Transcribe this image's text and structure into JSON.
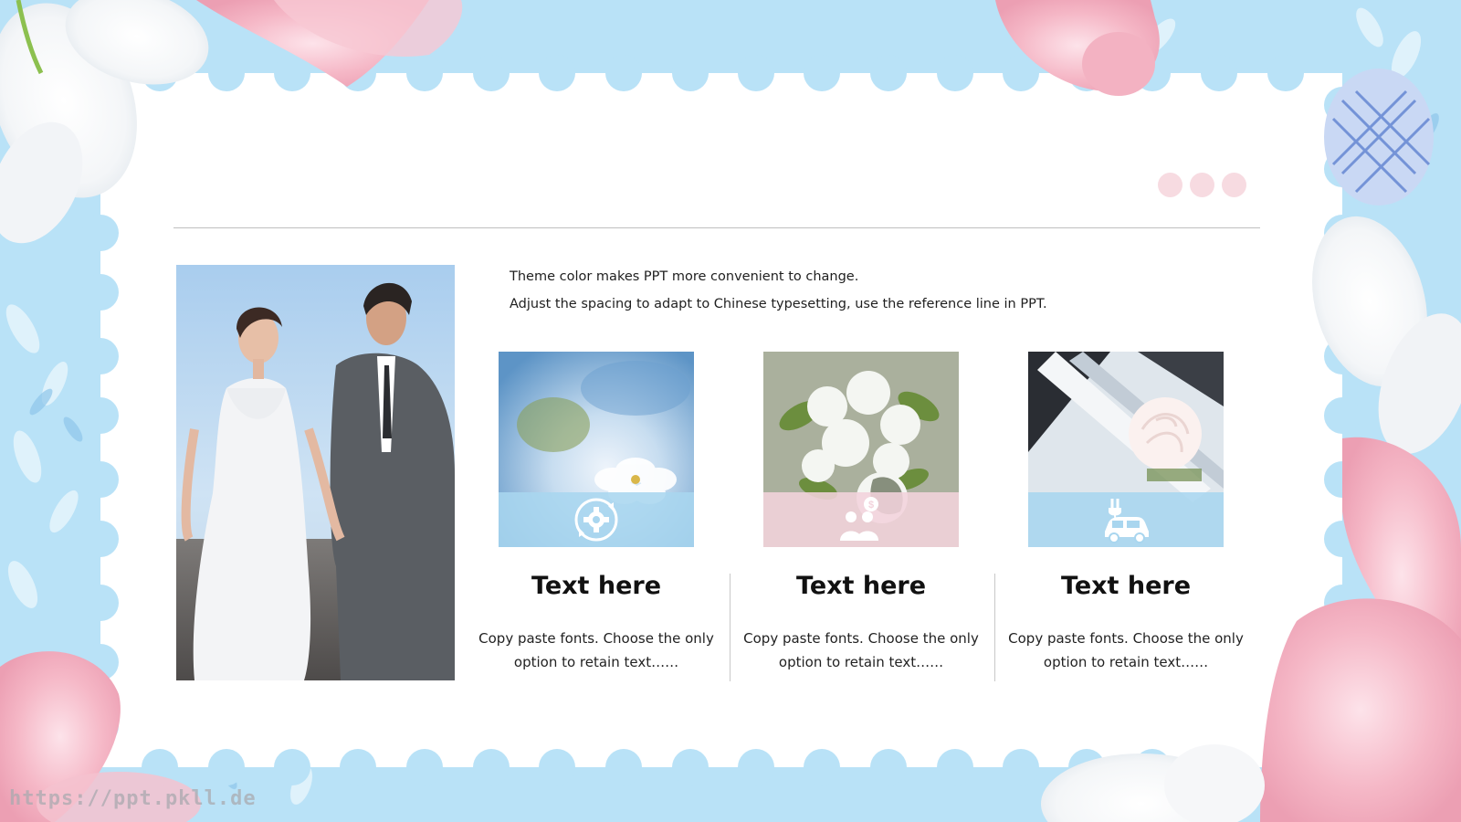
{
  "slide": {
    "lines": [
      "Theme color makes PPT more convenient to change.",
      "Adjust the spacing to adapt to Chinese typesetting, use the reference line in PPT."
    ],
    "columns": [
      {
        "title": "Text here",
        "body": "Copy paste fonts. Choose the only option to retain text……",
        "icon": "gear-refresh-icon"
      },
      {
        "title": "Text here",
        "body": "Copy paste fonts. Choose the only option to retain text……",
        "icon": "people-dollar-icon"
      },
      {
        "title": "Text here",
        "body": "Copy paste fonts. Choose the only option to retain text……",
        "icon": "electric-car-icon"
      }
    ],
    "watermark": "https://ppt.pkll.de"
  },
  "colors": {
    "sky": "#b9e2f7",
    "band_blue": "#a9d6ef",
    "band_pink": "#f3d3dc",
    "dot_pink": "#f7dbe1"
  }
}
